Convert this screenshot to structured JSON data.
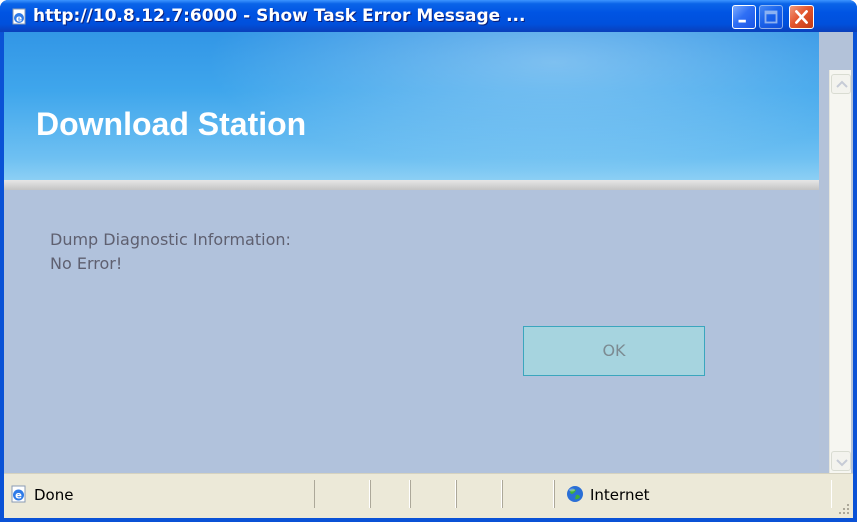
{
  "window": {
    "title": "http://10.8.12.7:6000 - Show Task Error Message ...",
    "icon": "ie-page-icon",
    "buttons": {
      "minimize": "minimize-icon",
      "maximize": "maximize-icon",
      "close": "close-icon"
    }
  },
  "banner": {
    "title": "Download Station"
  },
  "message": {
    "label": "Dump Diagnostic Information:",
    "value": "No Error!"
  },
  "actions": {
    "ok_label": "OK"
  },
  "statusbar": {
    "status_text": "Done",
    "zone_text": "Internet",
    "status_icon": "ie-page-icon",
    "zone_icon": "globe-icon"
  },
  "colors": {
    "titlebar": "#0054e3",
    "banner": "#3fa6ec",
    "content_bg": "#b1c2dc",
    "ok_bg": "#a6d4df",
    "statusbar": "#ece9d8"
  }
}
